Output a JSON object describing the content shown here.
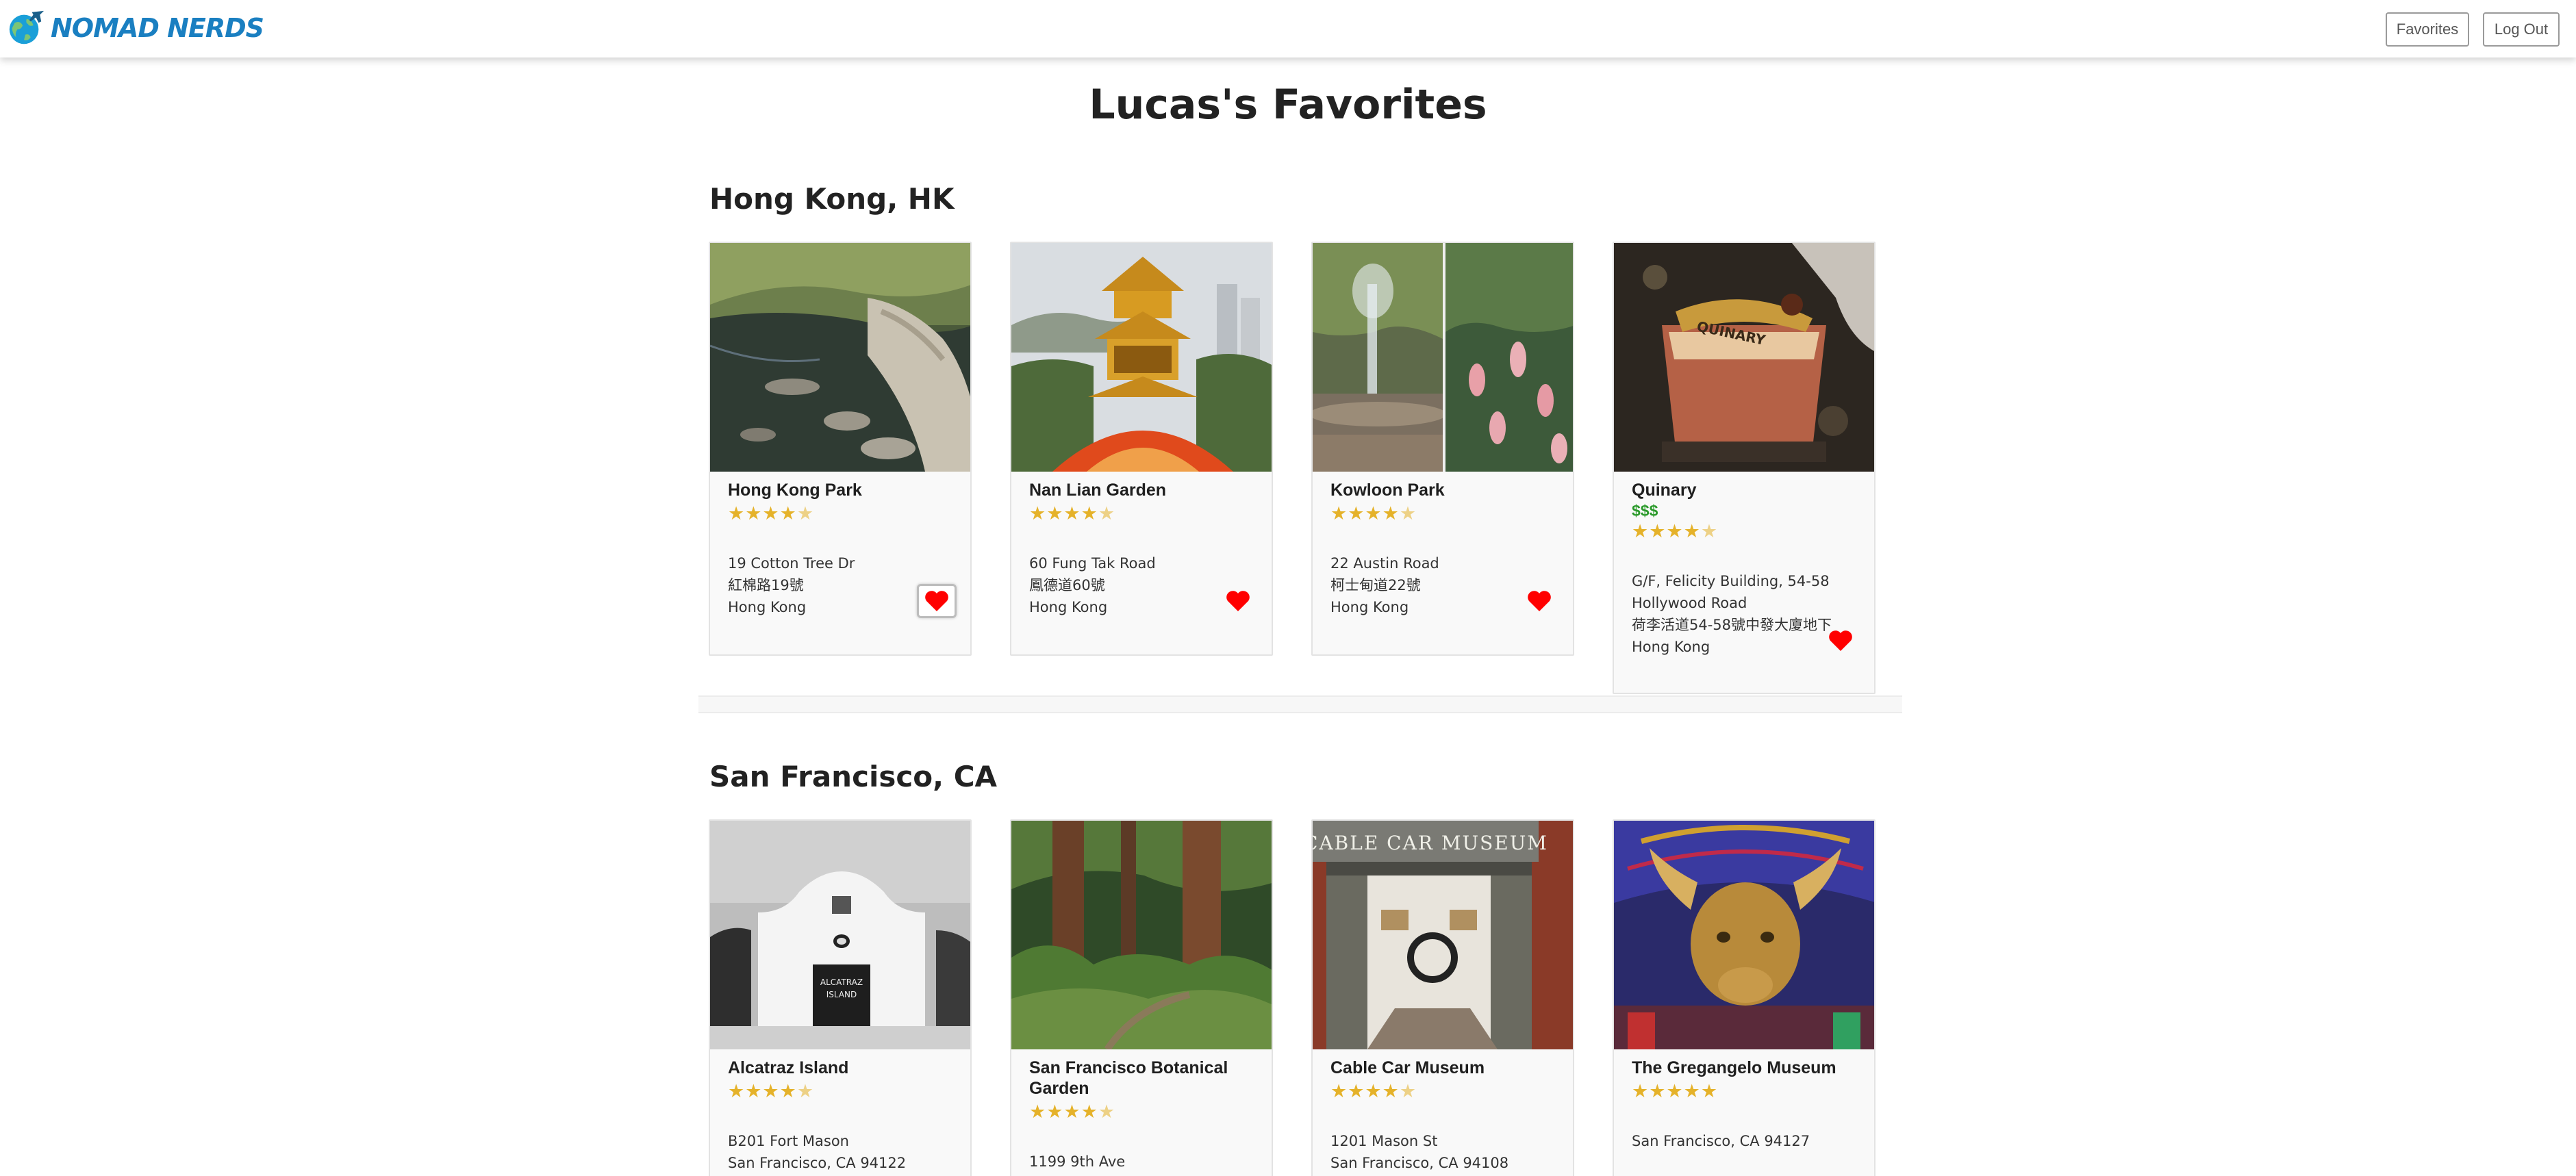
{
  "header": {
    "logo_text": "NOMAD NERDS",
    "favorites_label": "Favorites",
    "logout_label": "Log Out"
  },
  "page": {
    "title": "Lucas's Favorites"
  },
  "colors": {
    "brand": "#1a7fc1",
    "star": "#e5b22a",
    "heart": "#ff0000",
    "price": "#2b9a2b"
  },
  "sections": [
    {
      "title": "Hong Kong, HK",
      "cards": [
        {
          "name": "Hong Kong Park",
          "rating": 4.5,
          "price": "",
          "address": [
            "19 Cotton Tree Dr",
            "紅棉路19號",
            "Hong Kong"
          ],
          "favorited": true,
          "image_icon": "park-pond-photo"
        },
        {
          "name": "Nan Lian Garden",
          "rating": 4.5,
          "price": "",
          "address": [
            "60 Fung Tak Road",
            "鳳德道60號",
            "Hong Kong"
          ],
          "favorited": true,
          "image_icon": "pagoda-photo"
        },
        {
          "name": "Kowloon Park",
          "rating": 4.5,
          "price": "",
          "address": [
            "22 Austin Road",
            "柯士甸道22號",
            "Hong Kong"
          ],
          "favorited": true,
          "image_icon": "fountain-flamingo-photo"
        },
        {
          "name": "Quinary",
          "rating": 4.5,
          "price": "$$$",
          "address": [
            "G/F, Felicity Building, 54-58",
            "Hollywood Road",
            "荷李活道54-58號中發大廈地下",
            "Hong Kong"
          ],
          "favorited": true,
          "image_icon": "cocktail-photo"
        }
      ]
    },
    {
      "title": "San Francisco, CA",
      "cards": [
        {
          "name": "Alcatraz Island",
          "rating": 4.5,
          "price": "",
          "address": [
            "B201 Fort Mason",
            "San Francisco, CA 94122"
          ],
          "favorited": true,
          "image_icon": "alcatraz-building-photo"
        },
        {
          "name": "San Francisco Botanical Garden",
          "rating": 4.5,
          "price": "",
          "address": [
            "1199 9th Ave"
          ],
          "favorited": true,
          "image_icon": "forest-photo"
        },
        {
          "name": "Cable Car Museum",
          "rating": 4.5,
          "price": "",
          "address": [
            "1201 Mason St",
            "San Francisco, CA 94108"
          ],
          "favorited": true,
          "image_icon": "museum-entrance-photo"
        },
        {
          "name": "The Gregangelo Museum",
          "rating": 5,
          "price": "",
          "address": [
            "San Francisco, CA 94127"
          ],
          "favorited": true,
          "image_icon": "golden-bull-photo"
        }
      ]
    }
  ]
}
